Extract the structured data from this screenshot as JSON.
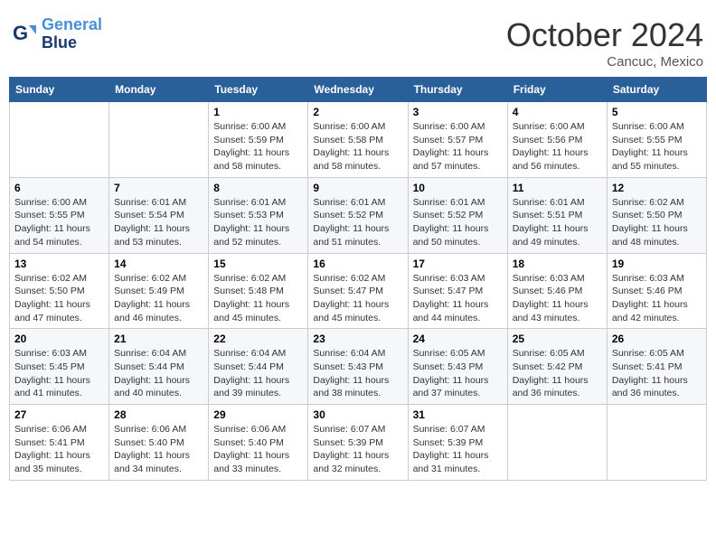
{
  "header": {
    "logo_line1": "General",
    "logo_line2": "Blue",
    "month": "October 2024",
    "location": "Cancuc, Mexico"
  },
  "weekdays": [
    "Sunday",
    "Monday",
    "Tuesday",
    "Wednesday",
    "Thursday",
    "Friday",
    "Saturday"
  ],
  "weeks": [
    [
      {
        "day": "",
        "info": ""
      },
      {
        "day": "",
        "info": ""
      },
      {
        "day": "1",
        "info": "Sunrise: 6:00 AM\nSunset: 5:59 PM\nDaylight: 11 hours and 58 minutes."
      },
      {
        "day": "2",
        "info": "Sunrise: 6:00 AM\nSunset: 5:58 PM\nDaylight: 11 hours and 58 minutes."
      },
      {
        "day": "3",
        "info": "Sunrise: 6:00 AM\nSunset: 5:57 PM\nDaylight: 11 hours and 57 minutes."
      },
      {
        "day": "4",
        "info": "Sunrise: 6:00 AM\nSunset: 5:56 PM\nDaylight: 11 hours and 56 minutes."
      },
      {
        "day": "5",
        "info": "Sunrise: 6:00 AM\nSunset: 5:55 PM\nDaylight: 11 hours and 55 minutes."
      }
    ],
    [
      {
        "day": "6",
        "info": "Sunrise: 6:00 AM\nSunset: 5:55 PM\nDaylight: 11 hours and 54 minutes."
      },
      {
        "day": "7",
        "info": "Sunrise: 6:01 AM\nSunset: 5:54 PM\nDaylight: 11 hours and 53 minutes."
      },
      {
        "day": "8",
        "info": "Sunrise: 6:01 AM\nSunset: 5:53 PM\nDaylight: 11 hours and 52 minutes."
      },
      {
        "day": "9",
        "info": "Sunrise: 6:01 AM\nSunset: 5:52 PM\nDaylight: 11 hours and 51 minutes."
      },
      {
        "day": "10",
        "info": "Sunrise: 6:01 AM\nSunset: 5:52 PM\nDaylight: 11 hours and 50 minutes."
      },
      {
        "day": "11",
        "info": "Sunrise: 6:01 AM\nSunset: 5:51 PM\nDaylight: 11 hours and 49 minutes."
      },
      {
        "day": "12",
        "info": "Sunrise: 6:02 AM\nSunset: 5:50 PM\nDaylight: 11 hours and 48 minutes."
      }
    ],
    [
      {
        "day": "13",
        "info": "Sunrise: 6:02 AM\nSunset: 5:50 PM\nDaylight: 11 hours and 47 minutes."
      },
      {
        "day": "14",
        "info": "Sunrise: 6:02 AM\nSunset: 5:49 PM\nDaylight: 11 hours and 46 minutes."
      },
      {
        "day": "15",
        "info": "Sunrise: 6:02 AM\nSunset: 5:48 PM\nDaylight: 11 hours and 45 minutes."
      },
      {
        "day": "16",
        "info": "Sunrise: 6:02 AM\nSunset: 5:47 PM\nDaylight: 11 hours and 45 minutes."
      },
      {
        "day": "17",
        "info": "Sunrise: 6:03 AM\nSunset: 5:47 PM\nDaylight: 11 hours and 44 minutes."
      },
      {
        "day": "18",
        "info": "Sunrise: 6:03 AM\nSunset: 5:46 PM\nDaylight: 11 hours and 43 minutes."
      },
      {
        "day": "19",
        "info": "Sunrise: 6:03 AM\nSunset: 5:46 PM\nDaylight: 11 hours and 42 minutes."
      }
    ],
    [
      {
        "day": "20",
        "info": "Sunrise: 6:03 AM\nSunset: 5:45 PM\nDaylight: 11 hours and 41 minutes."
      },
      {
        "day": "21",
        "info": "Sunrise: 6:04 AM\nSunset: 5:44 PM\nDaylight: 11 hours and 40 minutes."
      },
      {
        "day": "22",
        "info": "Sunrise: 6:04 AM\nSunset: 5:44 PM\nDaylight: 11 hours and 39 minutes."
      },
      {
        "day": "23",
        "info": "Sunrise: 6:04 AM\nSunset: 5:43 PM\nDaylight: 11 hours and 38 minutes."
      },
      {
        "day": "24",
        "info": "Sunrise: 6:05 AM\nSunset: 5:43 PM\nDaylight: 11 hours and 37 minutes."
      },
      {
        "day": "25",
        "info": "Sunrise: 6:05 AM\nSunset: 5:42 PM\nDaylight: 11 hours and 36 minutes."
      },
      {
        "day": "26",
        "info": "Sunrise: 6:05 AM\nSunset: 5:41 PM\nDaylight: 11 hours and 36 minutes."
      }
    ],
    [
      {
        "day": "27",
        "info": "Sunrise: 6:06 AM\nSunset: 5:41 PM\nDaylight: 11 hours and 35 minutes."
      },
      {
        "day": "28",
        "info": "Sunrise: 6:06 AM\nSunset: 5:40 PM\nDaylight: 11 hours and 34 minutes."
      },
      {
        "day": "29",
        "info": "Sunrise: 6:06 AM\nSunset: 5:40 PM\nDaylight: 11 hours and 33 minutes."
      },
      {
        "day": "30",
        "info": "Sunrise: 6:07 AM\nSunset: 5:39 PM\nDaylight: 11 hours and 32 minutes."
      },
      {
        "day": "31",
        "info": "Sunrise: 6:07 AM\nSunset: 5:39 PM\nDaylight: 11 hours and 31 minutes."
      },
      {
        "day": "",
        "info": ""
      },
      {
        "day": "",
        "info": ""
      }
    ]
  ]
}
